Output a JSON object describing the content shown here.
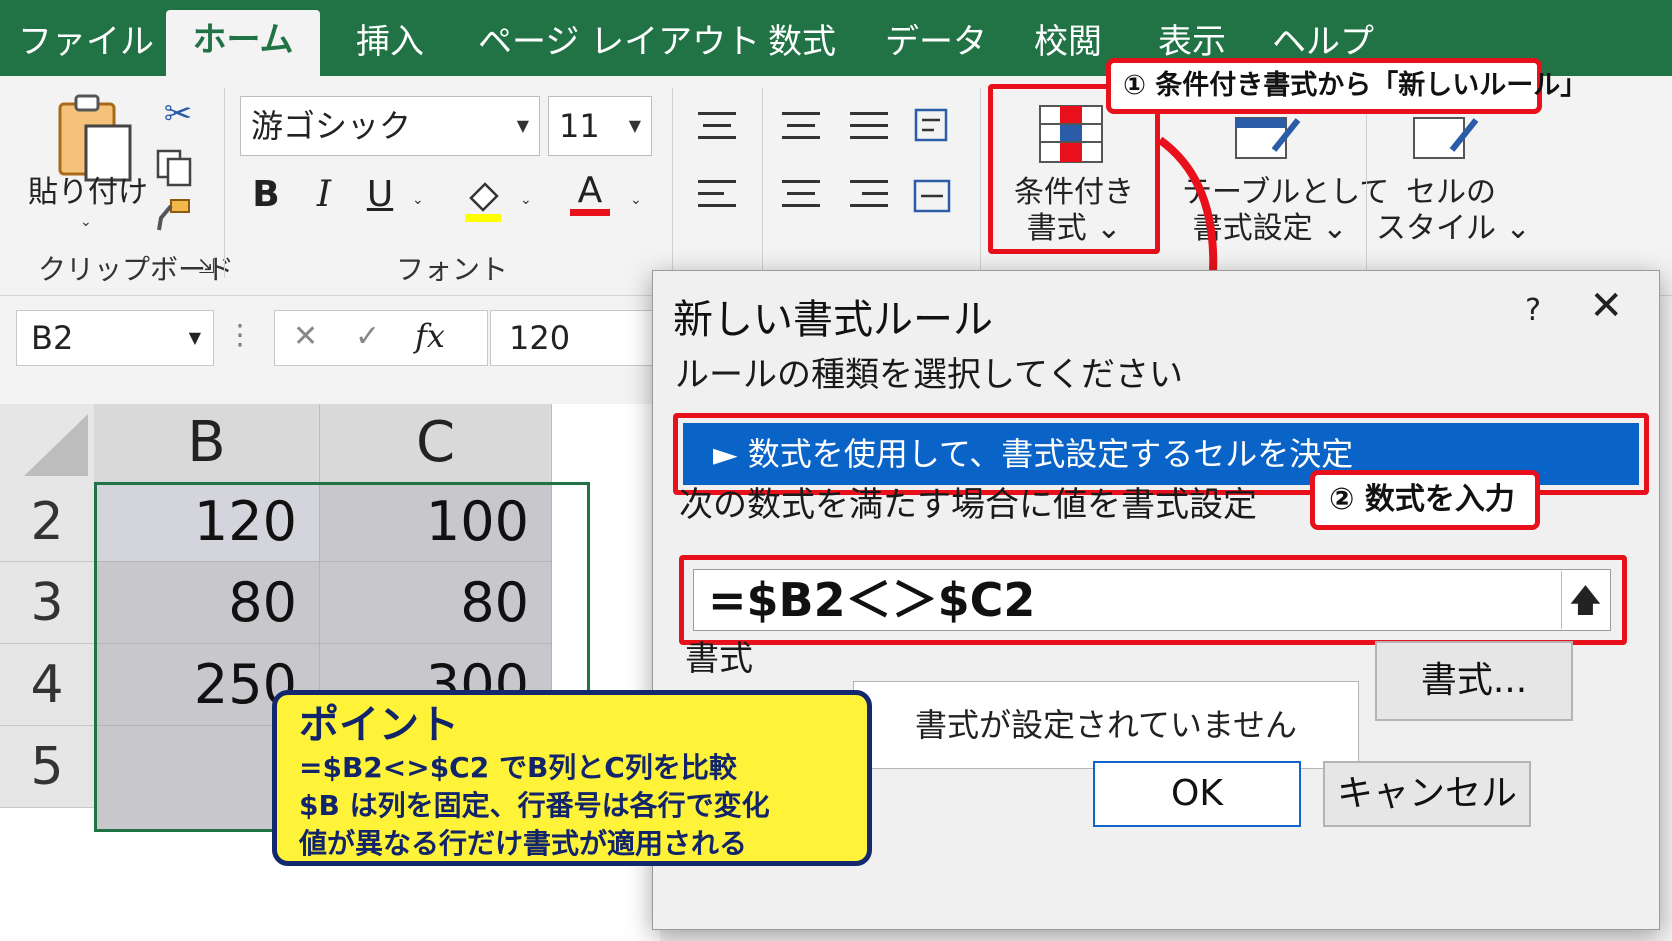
{
  "tabs": [
    "ファイル",
    "ホーム",
    "挿入",
    "ページ レイアウト",
    "数式",
    "データ",
    "校閲",
    "表示",
    "ヘルプ"
  ],
  "ribbon": {
    "clipboard": {
      "paste_label": "貼り付け",
      "group_label": "クリップボード"
    },
    "font": {
      "font_name": "游ゴシック",
      "font_size": "11",
      "bold": "B",
      "italic": "I",
      "underline": "U",
      "font_color_letter": "A",
      "group_label": "フォント"
    },
    "conditional_format": {
      "line1": "条件付き",
      "line2": "書式"
    },
    "format_as_table": {
      "line1": "テーブルとして",
      "line2": "書式設定"
    },
    "cell_styles": {
      "line1": "セルの",
      "line2": "スタイル"
    }
  },
  "formula_bar": {
    "name_box": "B2",
    "cancel": "✕",
    "enter": "✓",
    "fx": "fx",
    "value": "120"
  },
  "sheet": {
    "columns": [
      "B",
      "C"
    ],
    "rows": [
      {
        "num": "2",
        "b": "120",
        "c": "100"
      },
      {
        "num": "3",
        "b": "80",
        "c": "80"
      },
      {
        "num": "4",
        "b": "250",
        "c": "300"
      },
      {
        "num": "5",
        "b": "",
        "c": ""
      }
    ]
  },
  "dialog": {
    "title": "新しい書式ルール",
    "help": "?",
    "close": "✕",
    "rule_type_label": "ルールの種類を選択してください",
    "rule_type_selected": "► 数式を使用して、書式設定するセルを決定",
    "formula_label": "次の数式を満たす場合に値を書式設定",
    "formula": "=$B2＜＞$C2",
    "format_label": "書式",
    "preview_text": "書式が設定されていません",
    "format_button": "書式...",
    "ok": "OK",
    "cancel": "キャンセル"
  },
  "callouts": {
    "step1": "① 条件付き書式から「新しいルール」",
    "step2": "② 数式を入力",
    "point_title": "ポイント",
    "point_lines": [
      "=$B2<>$C2 でB列とC列を比較",
      "$B は列を固定、行番号は各行で変化",
      "値が異なる行だけ書式が適用される"
    ]
  },
  "colors": {
    "excel_green": "#217346",
    "highlight_red": "#e8101a",
    "selection_blue": "#0a64c8",
    "point_yellow": "#fff33a",
    "point_navy": "#14286e"
  }
}
